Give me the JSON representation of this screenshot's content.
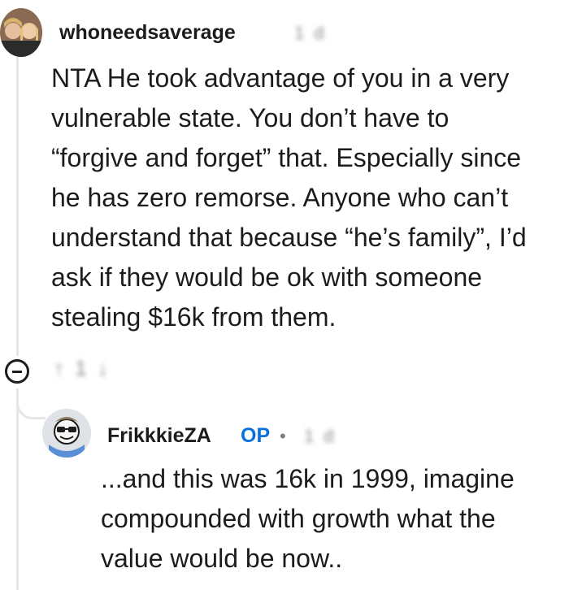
{
  "comment": {
    "username": "whoneedsaverage",
    "meta_blurred": "1 d",
    "body_lines": [
      "NTA He took advantage of you in a very",
      "vulnerable state. You don’t have to",
      "“forgive and forget” that. Especially since",
      "he has zero remorse. Anyone who can’t",
      "understand that because “he’s family”, I’d",
      "ask if they would be ok with someone",
      "stealing $16k from them."
    ],
    "actions_blurred": "↑ 1 ↓"
  },
  "reply": {
    "username": "FrikkkieZA",
    "op_badge": "OP",
    "separator": "•",
    "meta_blurred": "1 d",
    "body_lines": [
      "...and this was 16k in 1999, imagine",
      "compounded with growth what the",
      "value would be now.."
    ]
  },
  "colors": {
    "op_badge": "#0a6fe0",
    "text": "#1c1c1c",
    "thread_line": "#e6e6e6"
  }
}
